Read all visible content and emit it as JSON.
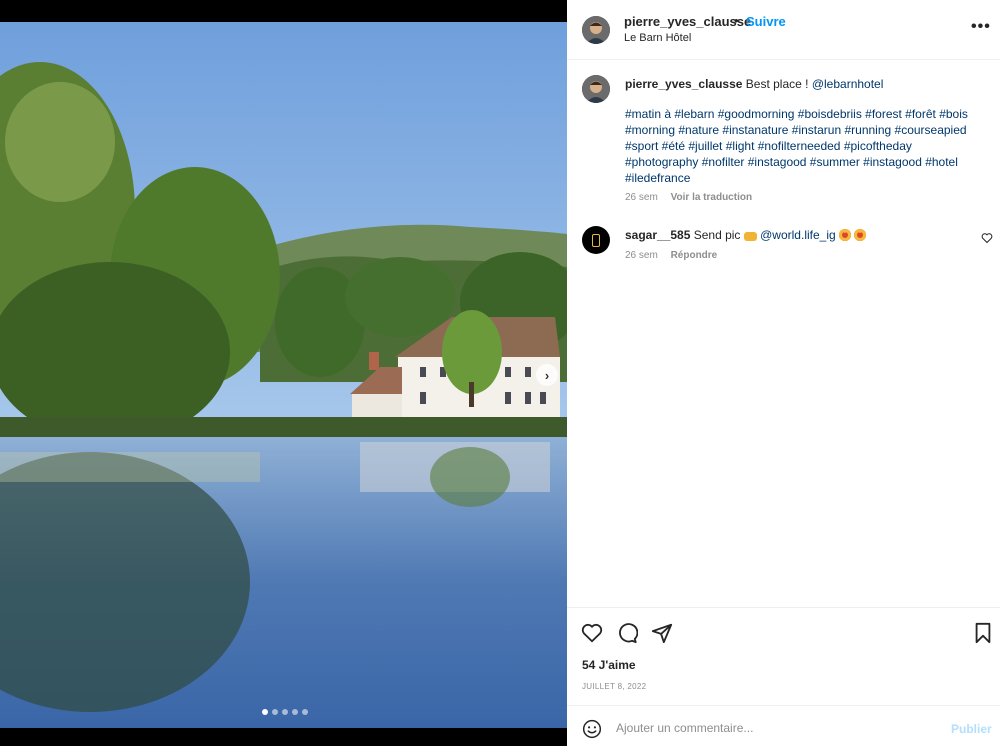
{
  "post": {
    "dots_total": 5,
    "active_dot": 0
  },
  "header": {
    "username": "pierre_yves_clausse",
    "separator": "•",
    "follow_label": "Suivre",
    "location": "Le Barn Hôtel",
    "more_label": "•••"
  },
  "caption": {
    "username": "pierre_yves_clausse",
    "text": "Best place ! ",
    "mention": "@lebarnhotel",
    "hashtags": "#matin à #lebarn #goodmorning #boisdebriis #forest #forêt #bois #morning #nature #instanature #instarun #running #courseapied #sport #été #juillet #light #nofilterneeded #picoftheday #photography #nofilter #instagood #summer #instagood #hotel #iledefrance",
    "time": "26 sem",
    "translate_label": "Voir la traduction"
  },
  "comments": [
    {
      "username": "sagar__585",
      "text": "Send pic",
      "mention": "@world.life_ig",
      "time": "26 sem",
      "reply_label": "Répondre"
    }
  ],
  "actions": {
    "likes": "54 J'aime",
    "date": "JUILLET 8, 2022"
  },
  "add_comment": {
    "placeholder": "Ajouter un commentaire...",
    "publish_label": "Publier"
  },
  "colors": {
    "link_blue": "#0095f6",
    "hashtag_blue": "#00376b",
    "muted": "#8e8e8e",
    "publish_disabled": "#b2dffc"
  }
}
